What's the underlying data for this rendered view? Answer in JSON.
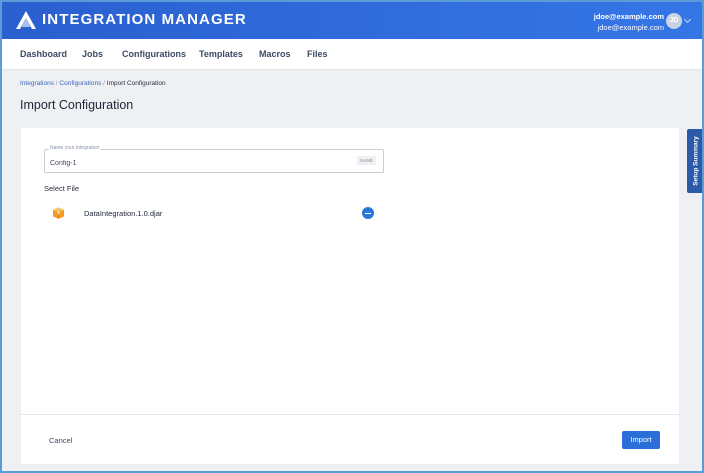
{
  "app": {
    "title": "INTEGRATION MANAGER",
    "brand_color": "#2f6ad9"
  },
  "user": {
    "email_primary": "jdoe@example.com",
    "email_secondary": "jdoe@example.com",
    "initials": "JD"
  },
  "nav": {
    "items": [
      {
        "label": "Dashboard"
      },
      {
        "label": "Jobs"
      },
      {
        "label": "Configurations"
      },
      {
        "label": "Templates"
      },
      {
        "label": "Macros"
      },
      {
        "label": "Files"
      }
    ]
  },
  "breadcrumb": {
    "items": [
      "Integrations",
      "Configurations",
      "Import Configuration"
    ],
    "separator": "/"
  },
  "page": {
    "title": "Import Configuration"
  },
  "form": {
    "name_label": "Name your Integration",
    "name_value": "Config-1",
    "name_badge": "NAME",
    "select_file_label": "Select File",
    "file": {
      "name": "DataIntegration.1.0.djar",
      "icon": "package-icon"
    }
  },
  "actions": {
    "cancel_label": "Cancel",
    "import_label": "Import"
  },
  "side_panel": {
    "label": "Setup Summary"
  }
}
